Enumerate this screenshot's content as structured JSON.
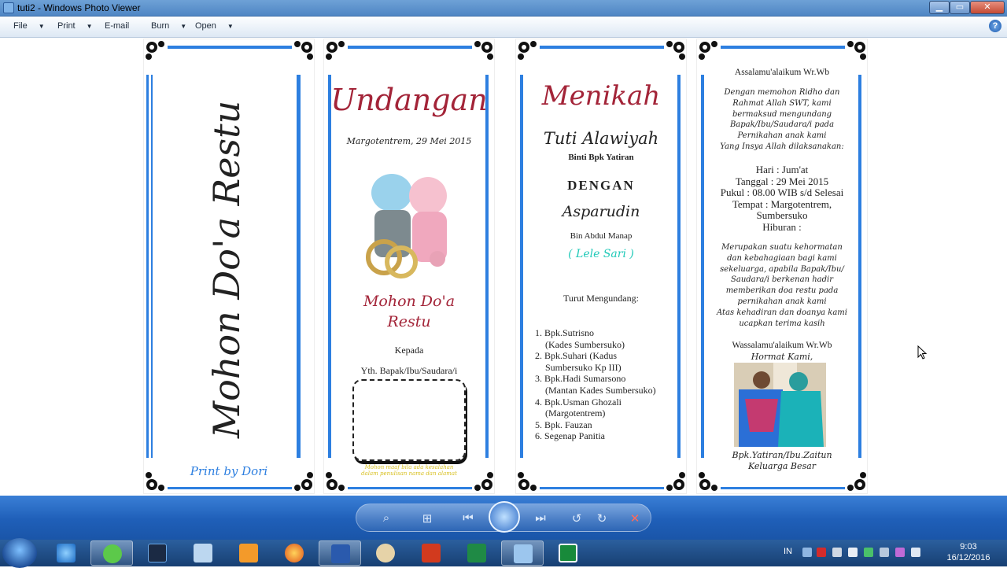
{
  "window": {
    "title": "tuti2 - Windows Photo Viewer",
    "min": "▁",
    "max": "▭",
    "close": "✕"
  },
  "menu": [
    {
      "label": "File",
      "arrow": "▼"
    },
    {
      "label": "Print",
      "arrow": "▼"
    },
    {
      "label": "E-mail",
      "arrow": ""
    },
    {
      "label": "Burn",
      "arrow": "▼"
    },
    {
      "label": "Open",
      "arrow": "▼"
    }
  ],
  "help": "?",
  "colors": {
    "border": "#2d7fe0",
    "red": "#a32438"
  },
  "panel1": {
    "title": "Mohon Do'a Restu",
    "print": "Print by Dori"
  },
  "panel2": {
    "title": "Undangan",
    "date": "Margotentrem, 29 Mei 2015",
    "mohon": "Mohon Do'a",
    "restu": "Restu",
    "kepada": "Kepada",
    "yth": "Yth. Bapak/Ibu/Saudara/i",
    "note": "Mohon maaf bila ada kesalahan dalam penulisan nama dan alamat"
  },
  "panel3": {
    "title": "Menikah",
    "bride": "Tuti Alawiyah",
    "bride_sub": "Binti Bpk Yatiran",
    "dengan": "DENGAN",
    "groom": "Asparudin",
    "groom_sub": "Bin Abdul Manap",
    "nick": "( Lele Sari )",
    "turut": "Turut Mengundang:",
    "list": [
      "1. Bpk.Sutrisno",
      "(Kades Sumbersuko)",
      "2. Bpk.Suhari (Kadus",
      "Sumbersuko Kp III)",
      "3. Bpk.Hadi Sumarsono",
      "(Mantan Kades Sumbersuko)",
      "4. Bpk.Usman Ghozali",
      "(Margotentrem)",
      "5. Bpk. Fauzan",
      "6. Segenap Panitia"
    ]
  },
  "panel4": {
    "salam": "Assalamu'alaikum Wr.Wb",
    "intro": [
      "Dengan memohon Ridho dan",
      "Rahmat Allah SWT, kami",
      "bermaksud mengundang",
      "Bapak/Ibu/Saudara/i pada",
      "Pernikahan anak kami",
      "Yang Insya Allah dilaksanakan:"
    ],
    "details": [
      "Hari : Jum'at",
      "Tanggal : 29 Mei 2015",
      "Pukul : 08.00 WIB s/d Selesai",
      "Tempat : Margotentrem,",
      "Sumbersuko",
      "Hiburan :"
    ],
    "closing": [
      "Merupakan suatu kehormatan",
      "dan kebahagiaan bagi kami",
      "sekeluarga, apabila Bapak/Ibu/",
      "Saudara/i berkenan hadir",
      "memberikan doa restu pada",
      "pernikahan anak kami",
      "Atas kehadiran dan doanya kami",
      "ucapkan terima kasih"
    ],
    "wassalam": "Wassalamu'alaikum Wr.Wb",
    "hormat": "Hormat Kami,",
    "sign1": "Bpk.Yatiran/Ibu.Zaitun",
    "sign2": "Keluarga Besar"
  },
  "controls": {
    "zoom": "⌕",
    "fit": "⊞",
    "prev": "⏮",
    "next": "⏭",
    "rotl": "↺",
    "rotr": "↻",
    "del": "✕"
  },
  "tray": {
    "lang": "IN",
    "time": "9:03",
    "date": "16/12/2016"
  }
}
